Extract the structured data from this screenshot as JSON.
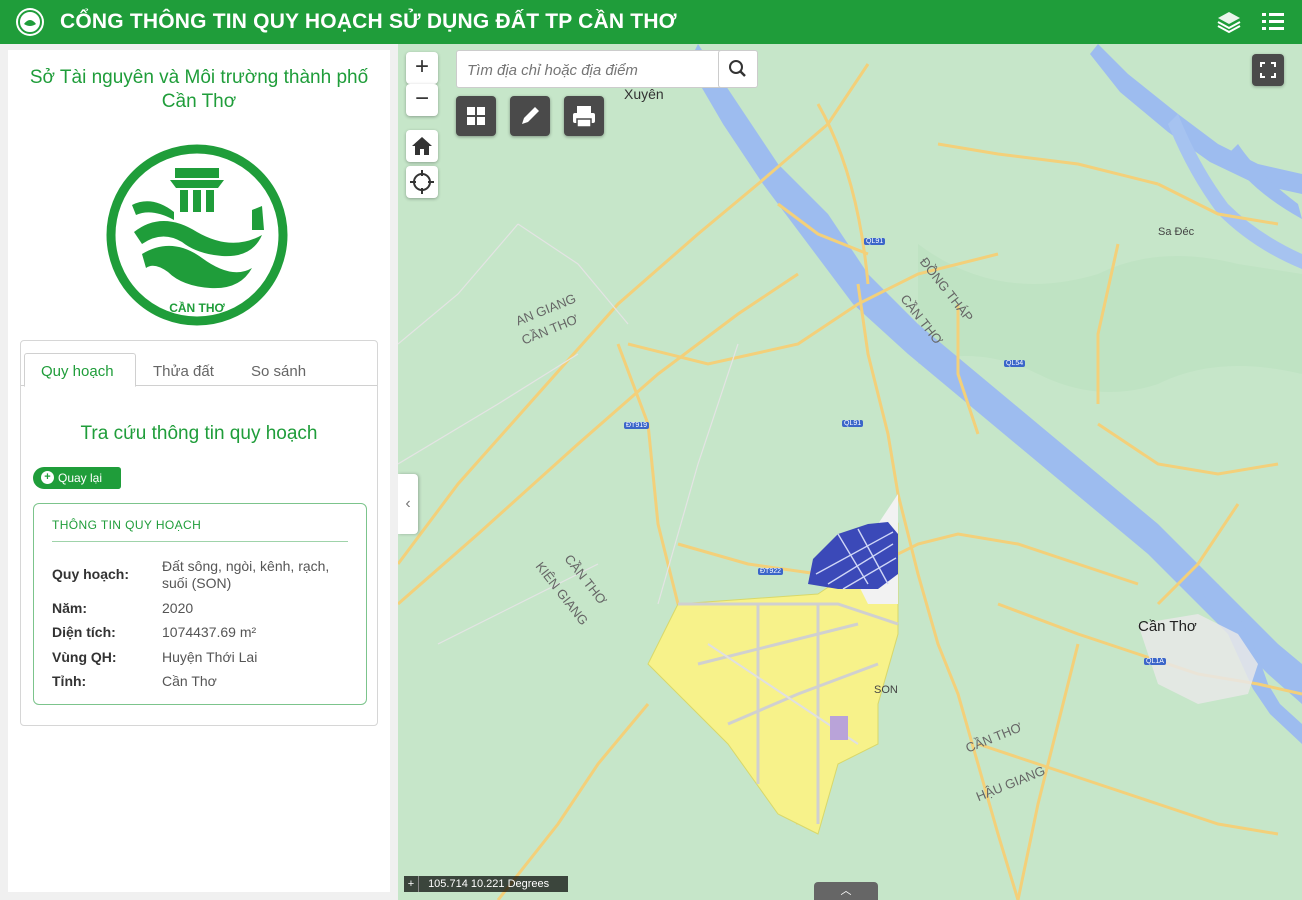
{
  "header": {
    "title": "CỔNG THÔNG TIN QUY HOẠCH SỬ DỤNG ĐẤT TP CẦN THƠ"
  },
  "sidebar": {
    "org_name": "Sở Tài nguyên và Môi trường thành phố Cần Thơ",
    "emblem_text": "CẦN THƠ",
    "tabs": [
      {
        "label": "Quy hoạch"
      },
      {
        "label": "Thửa đất"
      },
      {
        "label": "So sánh"
      }
    ],
    "lookup_title": "Tra cứu thông tin quy hoạch",
    "back_button": "Quay lại",
    "info": {
      "header": "THÔNG TIN QUY HOẠCH",
      "rows": [
        {
          "label": "Quy hoạch:",
          "value": "Đất sông, ngòi, kênh, rạch, suối (SON)"
        },
        {
          "label": "Năm:",
          "value": "2020"
        },
        {
          "label": "Diện tích:",
          "value": "1074437.69 m²"
        },
        {
          "label": "Vùng QH:",
          "value": "Huyện Thới Lai"
        },
        {
          "label": "Tỉnh:",
          "value": "Cần Thơ"
        }
      ]
    }
  },
  "map": {
    "search_placeholder": "Tìm địa chỉ hoặc địa điểm",
    "coordinates": "105.714 10.221 Degrees",
    "labels": {
      "xuyen": "Xuyên",
      "can_tho": "Cần Thơ",
      "an_giang": "AN GIANG",
      "can_tho_upper": "CẦN THƠ",
      "kien_giang": "KIÊN GIANG",
      "dong_thap": "ĐỒNG THÁP",
      "hau_giang": "HẬU GIANG",
      "sa_dec": "Sa Đéc",
      "son": "SON"
    },
    "colors": {
      "land": "#c6e6c9",
      "river": "#9dbcef",
      "road": "#f3d07a",
      "planning_yellow": "#f7f28a",
      "planning_blue": "#3b49b8"
    }
  }
}
